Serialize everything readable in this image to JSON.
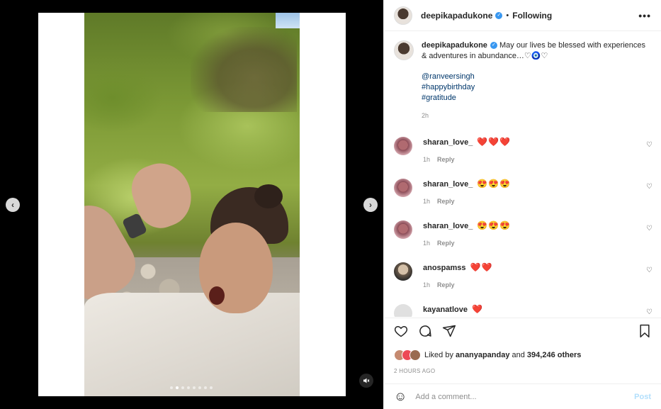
{
  "post": {
    "username": "deepikapadukone",
    "follow_sep": "•",
    "follow_status": "Following",
    "more": "•••",
    "caption_text": "May our lives be blessed with experiences & adventures in abundance…♡🧿♡",
    "mention": "@ranveersingh",
    "hashtag1": "#happybirthday",
    "hashtag2": "#gratitude",
    "caption_time": "2h"
  },
  "comments": [
    {
      "user": "sharan_love_",
      "text": "❤️❤️❤️",
      "time": "1h",
      "reply": "Reply"
    },
    {
      "user": "sharan_love_",
      "text": "😍😍😍",
      "time": "1h",
      "reply": "Reply"
    },
    {
      "user": "sharan_love_",
      "text": "😍😍😍",
      "time": "1h",
      "reply": "Reply"
    },
    {
      "user": "anospamss",
      "text": "❤️❤️",
      "time": "1h",
      "reply": "Reply"
    },
    {
      "user": "kayanatlove",
      "text": "❤️",
      "time": "",
      "reply": ""
    }
  ],
  "likes": {
    "prefix": "Liked by ",
    "user": "ananyapanday",
    "and": " and ",
    "count": "394,246 others"
  },
  "timestamp": "2 HOURS AGO",
  "composer": {
    "placeholder": "Add a comment...",
    "post_label": "Post"
  },
  "media": {
    "dot_count": 8,
    "active_dot_index": 1
  }
}
